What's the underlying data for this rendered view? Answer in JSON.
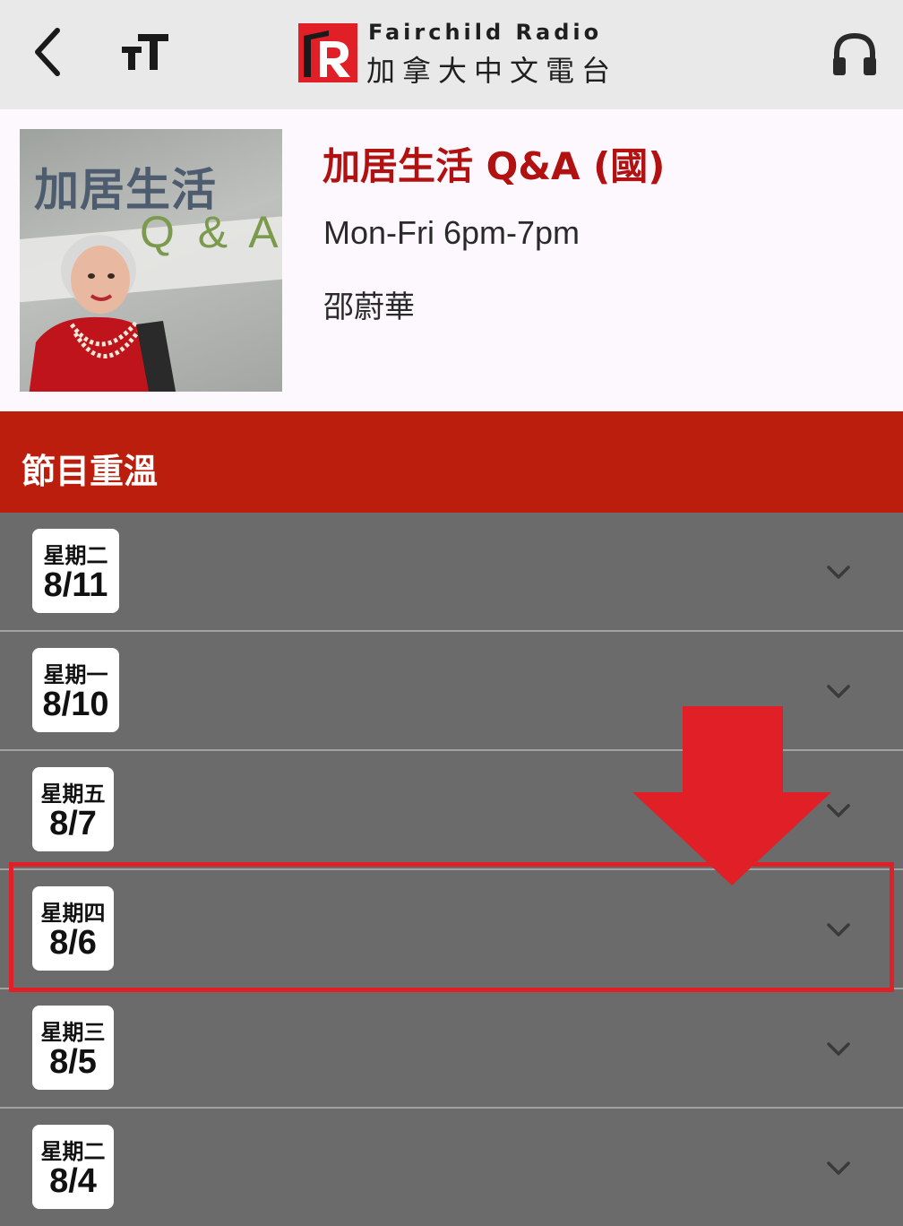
{
  "topbar": {
    "back_icon": "chevron-left-icon",
    "font_size_icon": "text-size-icon",
    "logo": {
      "name_en": "Fairchild Radio",
      "name_zh": "加拿大中文電台"
    },
    "listen_icon": "headphones-icon"
  },
  "program": {
    "cover_title": "加居生活",
    "cover_subtitle": "Q & A",
    "title": "加居生活 Q&A (國)",
    "schedule": "Mon-Fri 6pm-7pm",
    "host": "邵蔚華"
  },
  "section": {
    "title": "節目重溫"
  },
  "episodes": [
    {
      "day": "星期二",
      "date": "8/11"
    },
    {
      "day": "星期一",
      "date": "8/10"
    },
    {
      "day": "星期五",
      "date": "8/7"
    },
    {
      "day": "星期四",
      "date": "8/6"
    },
    {
      "day": "星期三",
      "date": "8/5"
    },
    {
      "day": "星期二",
      "date": "8/4"
    }
  ],
  "colors": {
    "brand_red": "#bb1e0c",
    "title_red": "#b11111",
    "annotation_red": "#e01f26",
    "list_gray": "#6b6b6b"
  },
  "annotation": {
    "highlighted_episode_index": 3,
    "arrow": "down-arrow"
  }
}
